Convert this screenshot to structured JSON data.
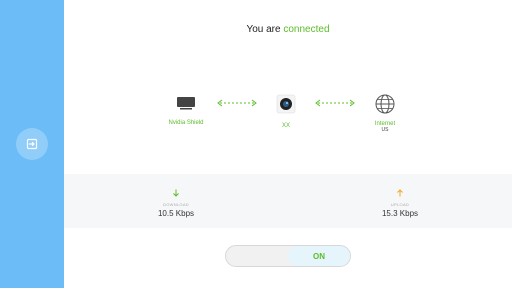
{
  "status": {
    "prefix": "You are ",
    "state": "connected"
  },
  "nodes": {
    "device": {
      "label": "Nvidia Shield",
      "icon": "tv-icon"
    },
    "vpn": {
      "label": "XX",
      "icon": "camera-lens-icon"
    },
    "internet": {
      "label": "Internet",
      "sub": "US",
      "icon": "globe-icon"
    }
  },
  "stats": {
    "download": {
      "caption": "DOWNLOAD",
      "value": "10.5 Kbps",
      "icon": "arrow-down-icon",
      "color": "#5cbd2a"
    },
    "upload": {
      "caption": "UPLOAD",
      "value": "15.3 Kbps",
      "icon": "arrow-up-icon",
      "color": "#f5a623"
    }
  },
  "toggle": {
    "label": "ON",
    "on": true
  },
  "sidebar": {
    "button_icon": "exit-icon"
  },
  "colors": {
    "accent": "#5cbd2a",
    "sidebar": "#6cbcf7",
    "upload": "#f5a623"
  }
}
